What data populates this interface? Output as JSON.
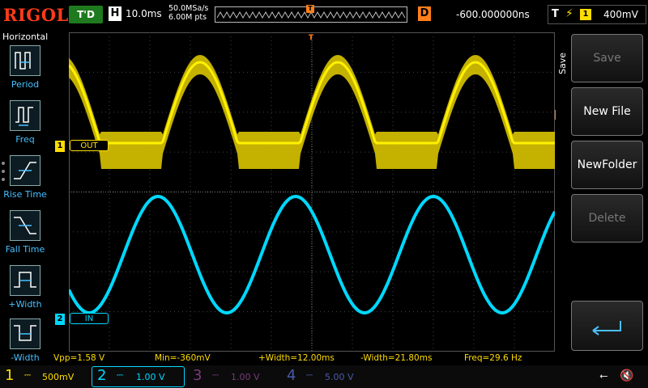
{
  "topbar": {
    "brand": "RIGOL",
    "run_state": "T'D",
    "horizontal_badge": "H",
    "timebase": "10.0ms",
    "sample_rate": "50.0MSa/s",
    "memory_depth": "6.00M pts",
    "trigger_marker": "T",
    "delay_badge": "D",
    "delay_value": "-600.000000ns",
    "trigger_badge": "T",
    "trigger_edge_icon": "rising-edge-icon",
    "trigger_source": "1",
    "trigger_level": "400mV"
  },
  "left_panel": {
    "title": "Horizontal",
    "items": [
      {
        "label": "Period",
        "icon": "period-icon"
      },
      {
        "label": "Freq",
        "icon": "frequency-icon"
      },
      {
        "label": "Rise Time",
        "icon": "rise-time-icon"
      },
      {
        "label": "Fall Time",
        "icon": "fall-time-icon"
      },
      {
        "label": "+Width",
        "icon": "positive-width-icon"
      },
      {
        "label": "-Width",
        "icon": "negative-width-icon"
      }
    ]
  },
  "channels_on_screen": {
    "ch1": {
      "number": "1",
      "name": "OUT",
      "color": "#ffdd00"
    },
    "ch2": {
      "number": "2",
      "name": "IN",
      "color": "#00d8ff"
    }
  },
  "trigger_position_marker": "T",
  "readout": {
    "vpp": "Vpp=1.58 V",
    "min": "Min=-360mV",
    "pos_width": "+Width=12.00ms",
    "neg_width": "-Width=21.80ms",
    "freq": "Freq=29.6 Hz"
  },
  "menu": {
    "title": "Save",
    "buttons": [
      {
        "label": "Save",
        "enabled": false
      },
      {
        "label": "New File",
        "enabled": true
      },
      {
        "label": "NewFolder",
        "enabled": true
      },
      {
        "label": "Delete",
        "enabled": false
      }
    ],
    "back_icon": "return-arrow-icon"
  },
  "bottom": {
    "channels": [
      {
        "number": "1",
        "coupling": "DC",
        "scale": "500mV",
        "color": "#ffdd00"
      },
      {
        "number": "2",
        "coupling": "DC",
        "scale": "1.00 V",
        "color": "#00d8ff"
      },
      {
        "number": "3",
        "coupling": "DC",
        "scale": "1.00 V",
        "color": "#7a3a7a"
      },
      {
        "number": "4",
        "coupling": "DC",
        "scale": "5.00 V",
        "color": "#3a4a8a"
      }
    ],
    "usb_icon": "usb-icon",
    "speaker_icon": "speaker-muted-icon"
  }
}
